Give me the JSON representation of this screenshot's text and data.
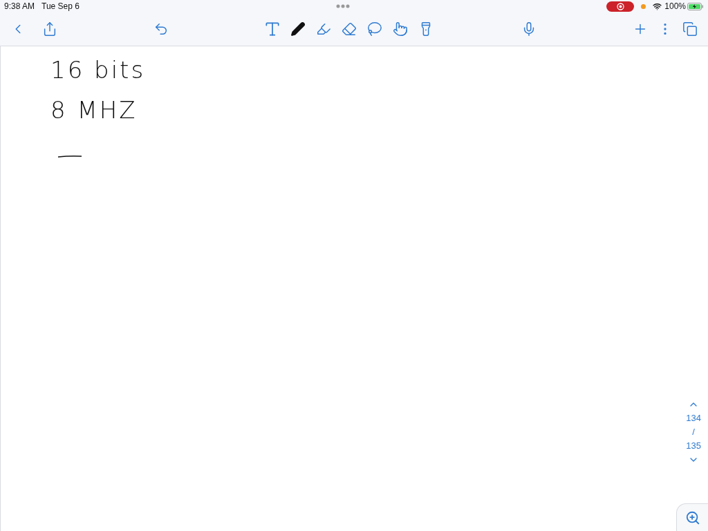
{
  "status_bar": {
    "time": "9:38 AM",
    "date": "Tue Sep 6",
    "recording": true,
    "battery": "100%"
  },
  "toolbar": {
    "left": [
      {
        "kind": "back"
      },
      {
        "kind": "share"
      },
      {
        "kind": "undo"
      }
    ],
    "tools": [
      {
        "kind": "text",
        "selected": false
      },
      {
        "kind": "pen",
        "selected": true
      },
      {
        "kind": "highlighter",
        "selected": false
      },
      {
        "kind": "eraser",
        "selected": false
      },
      {
        "kind": "lasso",
        "selected": false
      },
      {
        "kind": "hand",
        "selected": false
      },
      {
        "kind": "laser",
        "selected": false
      }
    ],
    "right": [
      {
        "kind": "mic"
      },
      {
        "kind": "add"
      },
      {
        "kind": "more"
      },
      {
        "kind": "pages"
      }
    ]
  },
  "page": {
    "lines": [
      "16 bits",
      "8 MHZ"
    ]
  },
  "page_nav": {
    "current": "134",
    "separator": "/",
    "total": "135"
  }
}
